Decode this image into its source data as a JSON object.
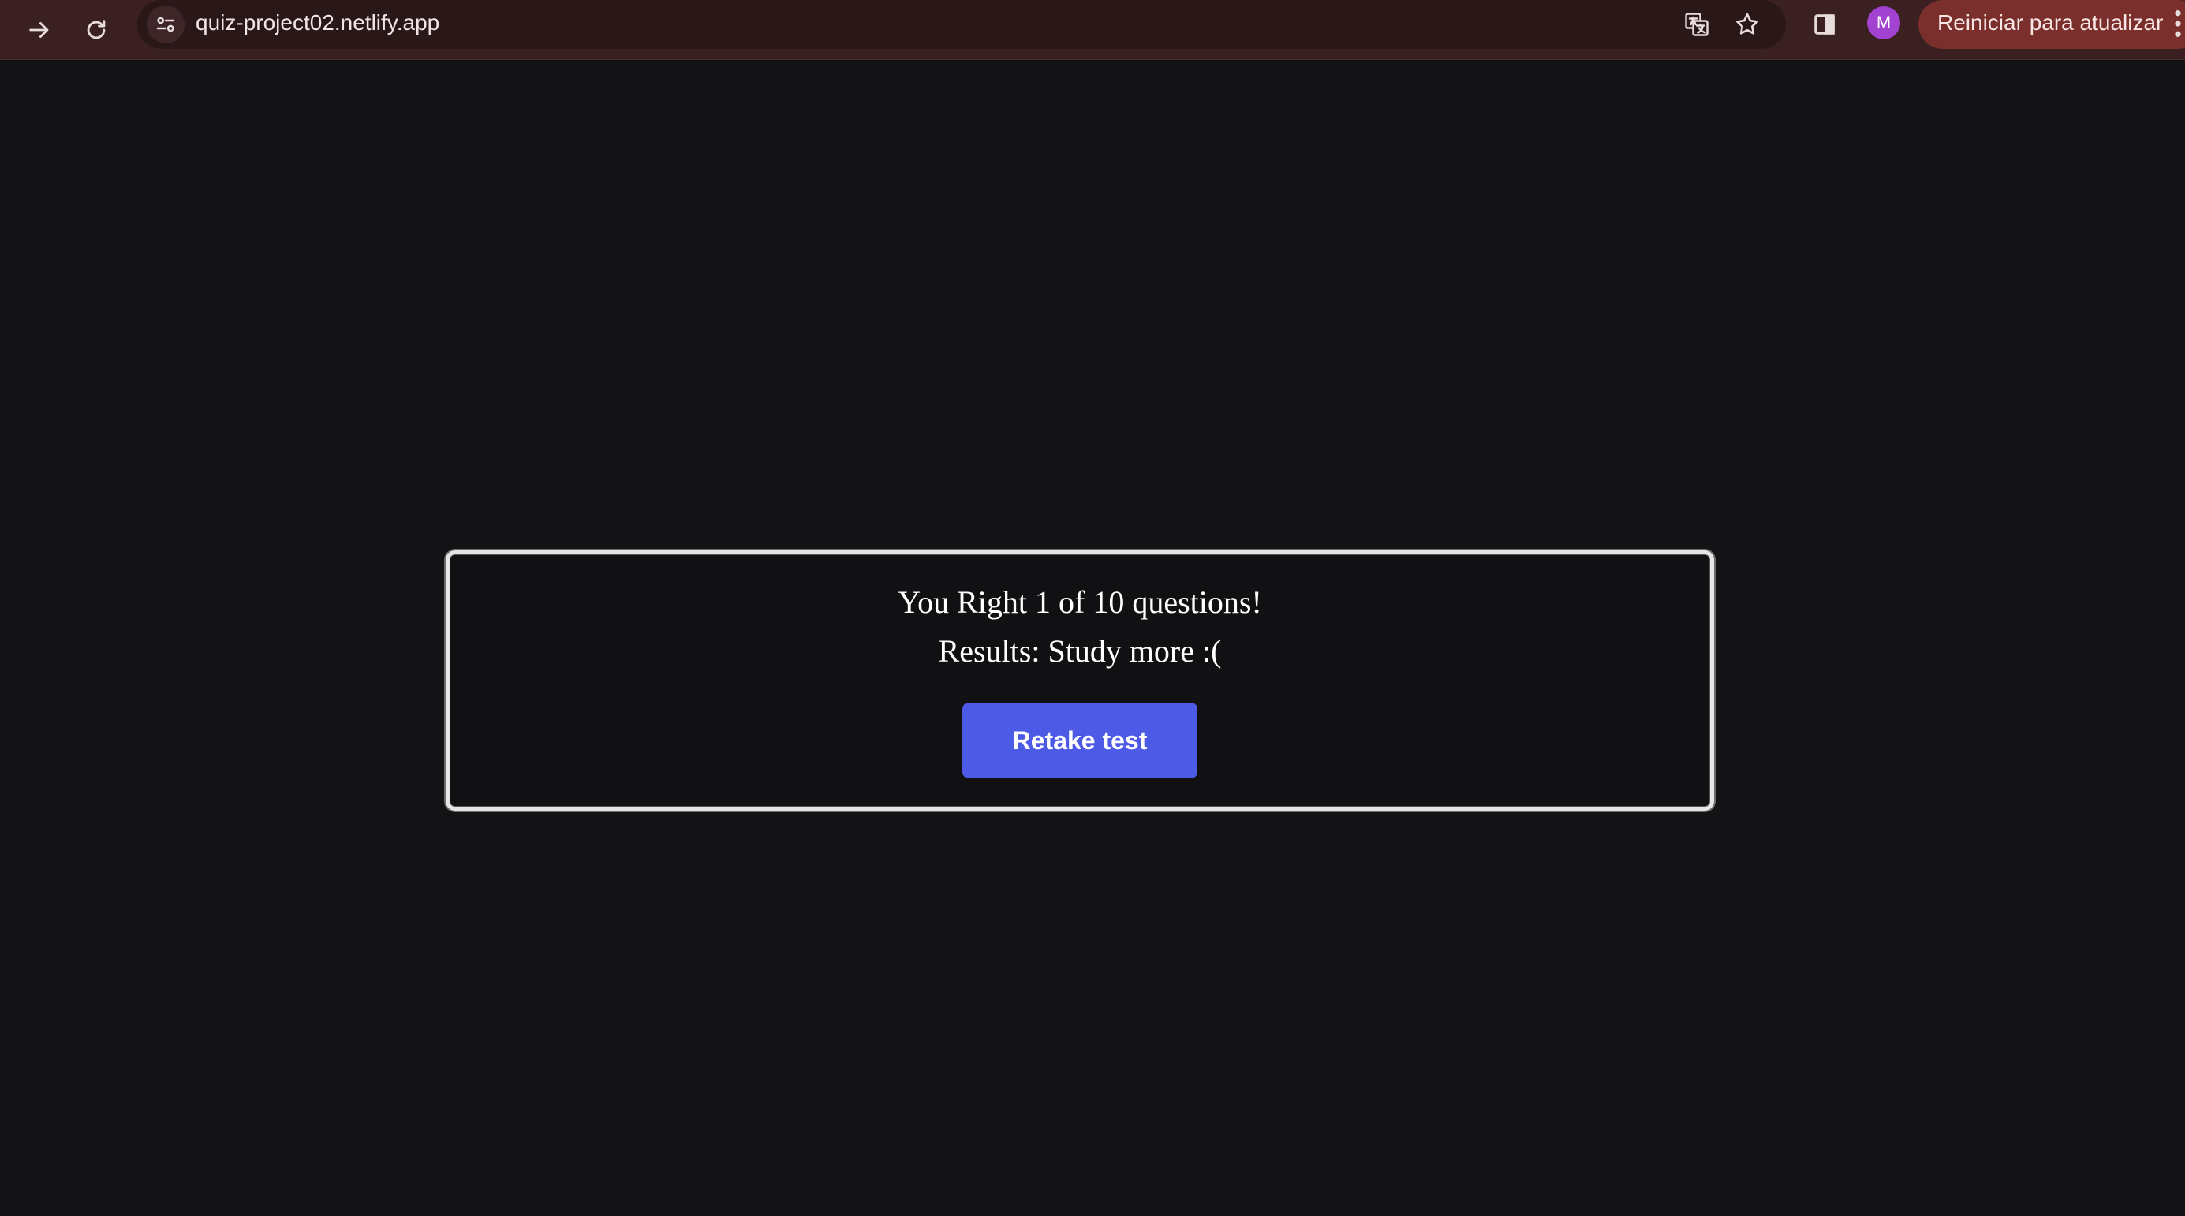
{
  "browser": {
    "url": "quiz-project02.netlify.app",
    "profile_initial": "M",
    "restart_label": "Reiniciar para atualizar",
    "icons": [
      "forward-icon",
      "reload-icon",
      "site-info-icon",
      "translate-icon",
      "bookmark-star-icon",
      "side-panel-icon",
      "menu-icon"
    ],
    "colors": {
      "toolbar": "#3b2022",
      "omnibox": "#2a1819",
      "avatar": "#a142d1",
      "restart_button": "#7a2f2c"
    }
  },
  "result": {
    "score_text": "You Right 1 of 10 questions!",
    "verdict_text": "Results: Study more :(",
    "retake_label": "Retake test"
  },
  "colors": {
    "page_background": "#131316",
    "card_border": "#e6e6e6",
    "retake_button": "#4c5ae6"
  }
}
